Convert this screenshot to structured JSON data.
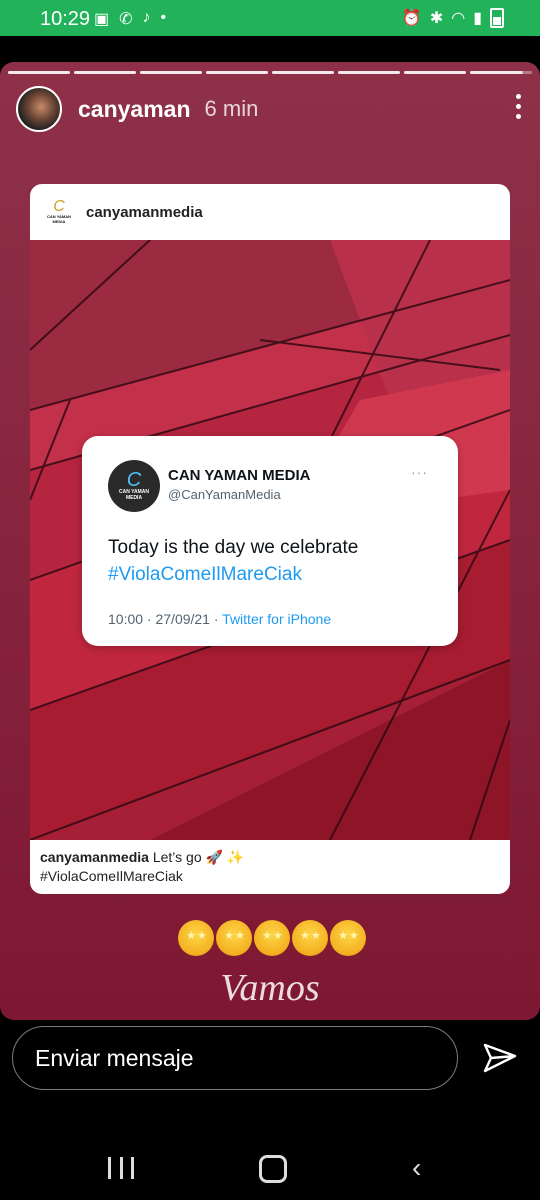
{
  "status_bar": {
    "time": "10:29",
    "left_icons": [
      "gallery-icon",
      "wifi-call-icon",
      "tiktok-icon",
      "dot-icon"
    ],
    "right_icons": [
      "alarm-icon",
      "bluetooth-icon",
      "wifi-icon",
      "signal-icon",
      "battery-icon"
    ],
    "bg_color": "#22b35a"
  },
  "story": {
    "segments_total": 8,
    "username": "canyaman",
    "time_ago": "6 min",
    "bg_color": "#86213b"
  },
  "post": {
    "username": "canyamanmedia",
    "logo_lines": [
      "C",
      "CAN YAMAN",
      "MEDIA"
    ],
    "tweet": {
      "name": "CAN YAMAN MEDIA",
      "handle": "@CanYamanMedia",
      "text": "Today is the day we celebrate",
      "hashtag": "#ViolaComeIlMareCiak",
      "timestamp": "10:00 · 27/09/21 · ",
      "source": "Twitter for iPhone",
      "more": "···"
    },
    "caption_user": "canyamanmedia",
    "caption_text": "Let’s go 🚀 ✨",
    "caption_hashtag": "#ViolaComeIlMareCiak"
  },
  "sticker": {
    "emoji_count": 5,
    "text": "Vamos"
  },
  "reply": {
    "placeholder": "Enviar mensaje"
  },
  "nav": [
    "recents-button",
    "home-button",
    "back-button"
  ]
}
